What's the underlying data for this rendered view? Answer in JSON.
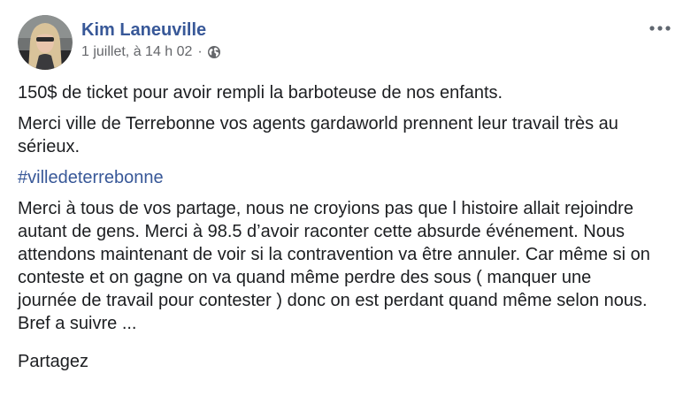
{
  "post": {
    "author": "Kim Laneuville",
    "timestamp": "1 juillet, à 14 h 02",
    "separator": "·",
    "privacy_icon": "globe-icon",
    "more_icon": "more-options-icon",
    "paragraph1": "150$ de ticket pour avoir rempli la barboteuse de nos enfants.",
    "paragraph2": "Merci ville de Terrebonne vos agents gardaworld prennent leur travail très au sérieux.",
    "hashtag": "#villedeterrebonne",
    "paragraph3": "Merci à tous de vos partage, nous ne croyions pas que l histoire allait rejoindre autant de gens. Merci à 98.5 d’avoir raconter cette absurde événement. Nous attendons maintenant de voir si la contravention va être annuler. Car même si on conteste et on gagne on va quand même perdre des sous ( manquer une journée de travail pour contester ) donc on est perdant quand même selon nous. Bref a suivre ...",
    "paragraph4": "Partagez"
  },
  "colors": {
    "link": "#385898",
    "text": "#1c1e21",
    "secondary": "#65676b"
  }
}
